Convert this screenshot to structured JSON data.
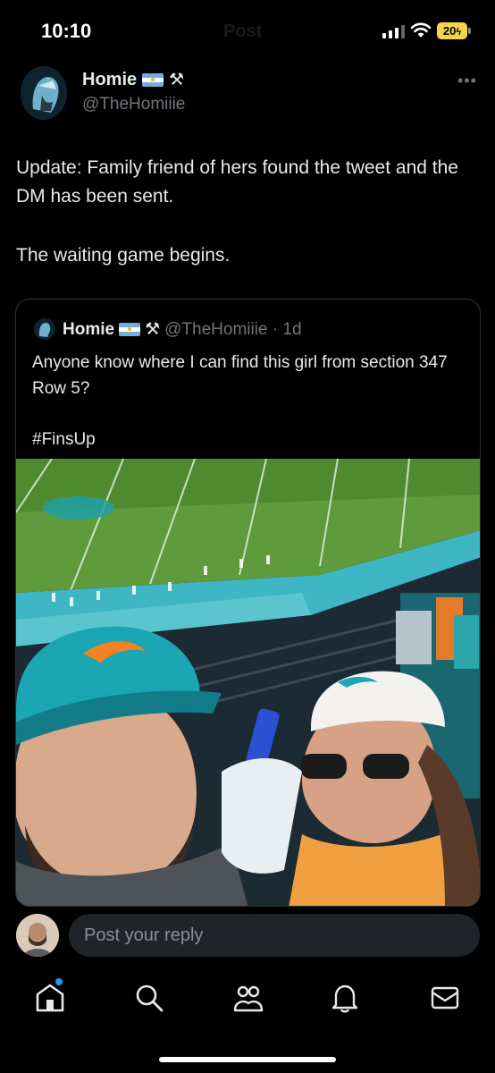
{
  "status_bar": {
    "time": "10:10",
    "ghost_title": "Post",
    "battery": "20"
  },
  "tweet": {
    "display_name": "Homie",
    "handle": "@TheHomiiie",
    "more_label": "•••",
    "paragraphs": [
      "Update: Family friend of hers found the tweet and the DM has been sent.",
      "The waiting game begins."
    ],
    "quoted": {
      "display_name": "Homie",
      "meta": "@TheHomiiie · 1d",
      "paragraphs": [
        "Anyone know where I can find this girl from section 347 Row 5?",
        "#FinsUp"
      ],
      "photo_icon": "stadium-selfie-photo"
    }
  },
  "reply": {
    "placeholder": "Post your reply"
  },
  "tab_bar": [
    {
      "name": "home",
      "icon": "home-icon"
    },
    {
      "name": "search",
      "icon": "search-icon"
    },
    {
      "name": "communities",
      "icon": "people-icon"
    },
    {
      "name": "notifications",
      "icon": "bell-icon"
    },
    {
      "name": "messages",
      "icon": "mail-icon"
    }
  ],
  "colors": {
    "background": "#000000",
    "text": "#e7e9ea",
    "muted": "#71767b",
    "accent": "#1d9bf0",
    "battery": "#f5d44c",
    "input_bg": "#202327"
  }
}
